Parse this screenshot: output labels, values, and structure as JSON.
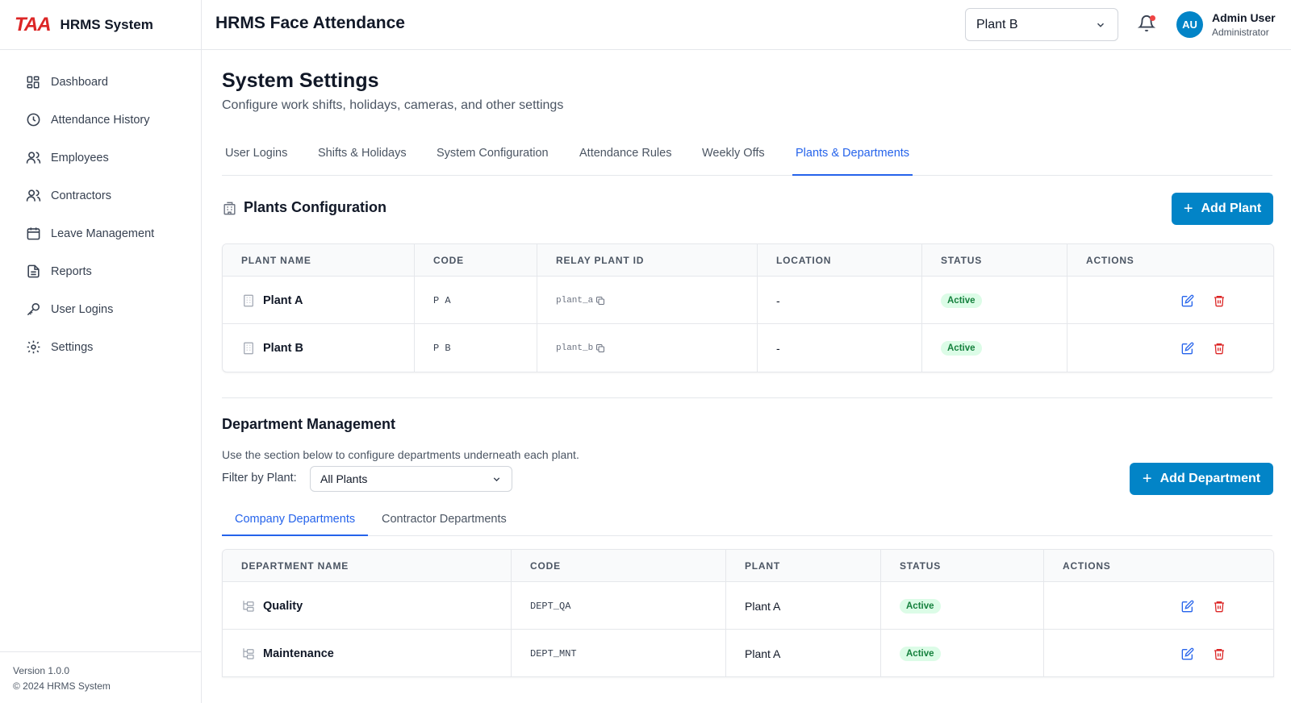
{
  "brand": {
    "logo": "TAA",
    "name": "HRMS System"
  },
  "sidebar": {
    "items": [
      {
        "label": "Dashboard",
        "icon": "dashboard-grid-icon"
      },
      {
        "label": "Attendance History",
        "icon": "clock-icon"
      },
      {
        "label": "Employees",
        "icon": "users-icon"
      },
      {
        "label": "Contractors",
        "icon": "users-icon"
      },
      {
        "label": "Leave Management",
        "icon": "calendar-icon"
      },
      {
        "label": "Reports",
        "icon": "file-text-icon"
      },
      {
        "label": "User Logins",
        "icon": "key-icon"
      },
      {
        "label": "Settings",
        "icon": "gear-icon"
      }
    ],
    "version": "Version 1.0.0",
    "copyright": "© 2024 HRMS System"
  },
  "header": {
    "title": "HRMS Face Attendance",
    "plant_selected": "Plant B",
    "user_initials": "AU",
    "user_name": "Admin User",
    "user_role": "Administrator"
  },
  "page": {
    "title": "System Settings",
    "subtitle": "Configure work shifts, holidays, cameras, and other settings",
    "tabs": [
      {
        "label": "User Logins"
      },
      {
        "label": "Shifts & Holidays"
      },
      {
        "label": "System Configuration"
      },
      {
        "label": "Attendance Rules"
      },
      {
        "label": "Weekly Offs"
      },
      {
        "label": "Plants & Departments",
        "active": true
      }
    ]
  },
  "plants": {
    "title": "Plants Configuration",
    "add_label": "Add Plant",
    "columns": [
      "PLANT NAME",
      "CODE",
      "RELAY PLANT ID",
      "LOCATION",
      "STATUS",
      "ACTIONS"
    ],
    "rows": [
      {
        "name": "Plant A",
        "code": "P A",
        "relay_id": "plant_a",
        "location": "-",
        "status": "Active"
      },
      {
        "name": "Plant B",
        "code": "P B",
        "relay_id": "plant_b",
        "location": "-",
        "status": "Active"
      }
    ]
  },
  "departments": {
    "title": "Department Management",
    "help": "Use the section below to configure departments underneath each plant.",
    "filter_label": "Filter by Plant:",
    "filter_value": "All Plants",
    "add_label": "Add Department",
    "subtabs": [
      {
        "label": "Company Departments",
        "active": true
      },
      {
        "label": "Contractor Departments"
      }
    ],
    "columns": [
      "DEPARTMENT NAME",
      "CODE",
      "PLANT",
      "STATUS",
      "ACTIONS"
    ],
    "rows": [
      {
        "name": "Quality",
        "code": "DEPT_QA",
        "plant": "Plant A",
        "status": "Active"
      },
      {
        "name": "Maintenance",
        "code": "DEPT_MNT",
        "plant": "Plant A",
        "status": "Active"
      }
    ]
  },
  "colors": {
    "primary": "#0284c7",
    "active_tab": "#2563eb",
    "danger": "#dc2626",
    "success_bg": "#dcfce7",
    "success_text": "#15803d"
  }
}
